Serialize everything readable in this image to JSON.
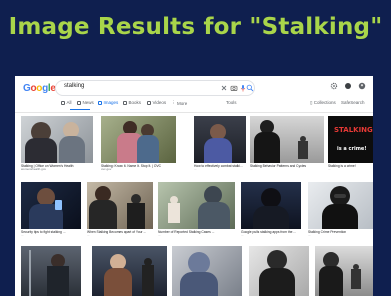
{
  "slide": {
    "title": "Image Results for \"Stalking\""
  },
  "google": {
    "logo": "Google",
    "search_query": "stalking",
    "tabs": [
      {
        "label": "All"
      },
      {
        "label": "News"
      },
      {
        "label": "Images"
      },
      {
        "label": "Books"
      },
      {
        "label": "Videos"
      },
      {
        "label": "More"
      }
    ],
    "tools_label": "Tools",
    "collections_label": "Collections",
    "safesearch_label": "SafeSearch"
  },
  "results": [
    {
      "caption": "Stalking | Office on Women's Health",
      "source": "womenshealth.gov"
    },
    {
      "caption": "Stalking: Know It. Name It. Stop It. | OVC",
      "source": "ovc.gov"
    },
    {
      "caption": "How to effectively combat stalki...",
      "source": "..."
    },
    {
      "caption": "Stalking Behavior Patterns and Cycles",
      "source": "..."
    },
    {
      "caption": "Stalking is a crime!",
      "source": "..."
    },
    {
      "caption": "Security tips to fight stalking ...",
      "source": "..."
    },
    {
      "caption": "When Stalking Becomes apart of Your ...",
      "source": "..."
    },
    {
      "caption": "Number of Reported Stalking Cases ...",
      "source": "..."
    },
    {
      "caption": "Google pulls stalking apps from the ...",
      "source": "..."
    },
    {
      "caption": "Stalking Crime Prevention",
      "source": "..."
    }
  ],
  "overlay": {
    "line1": "STALKING",
    "line2": "is a crime!"
  },
  "colors": {
    "background": "#0f1f4f",
    "title": "#a9d54a",
    "accent": "#1a73e8"
  }
}
